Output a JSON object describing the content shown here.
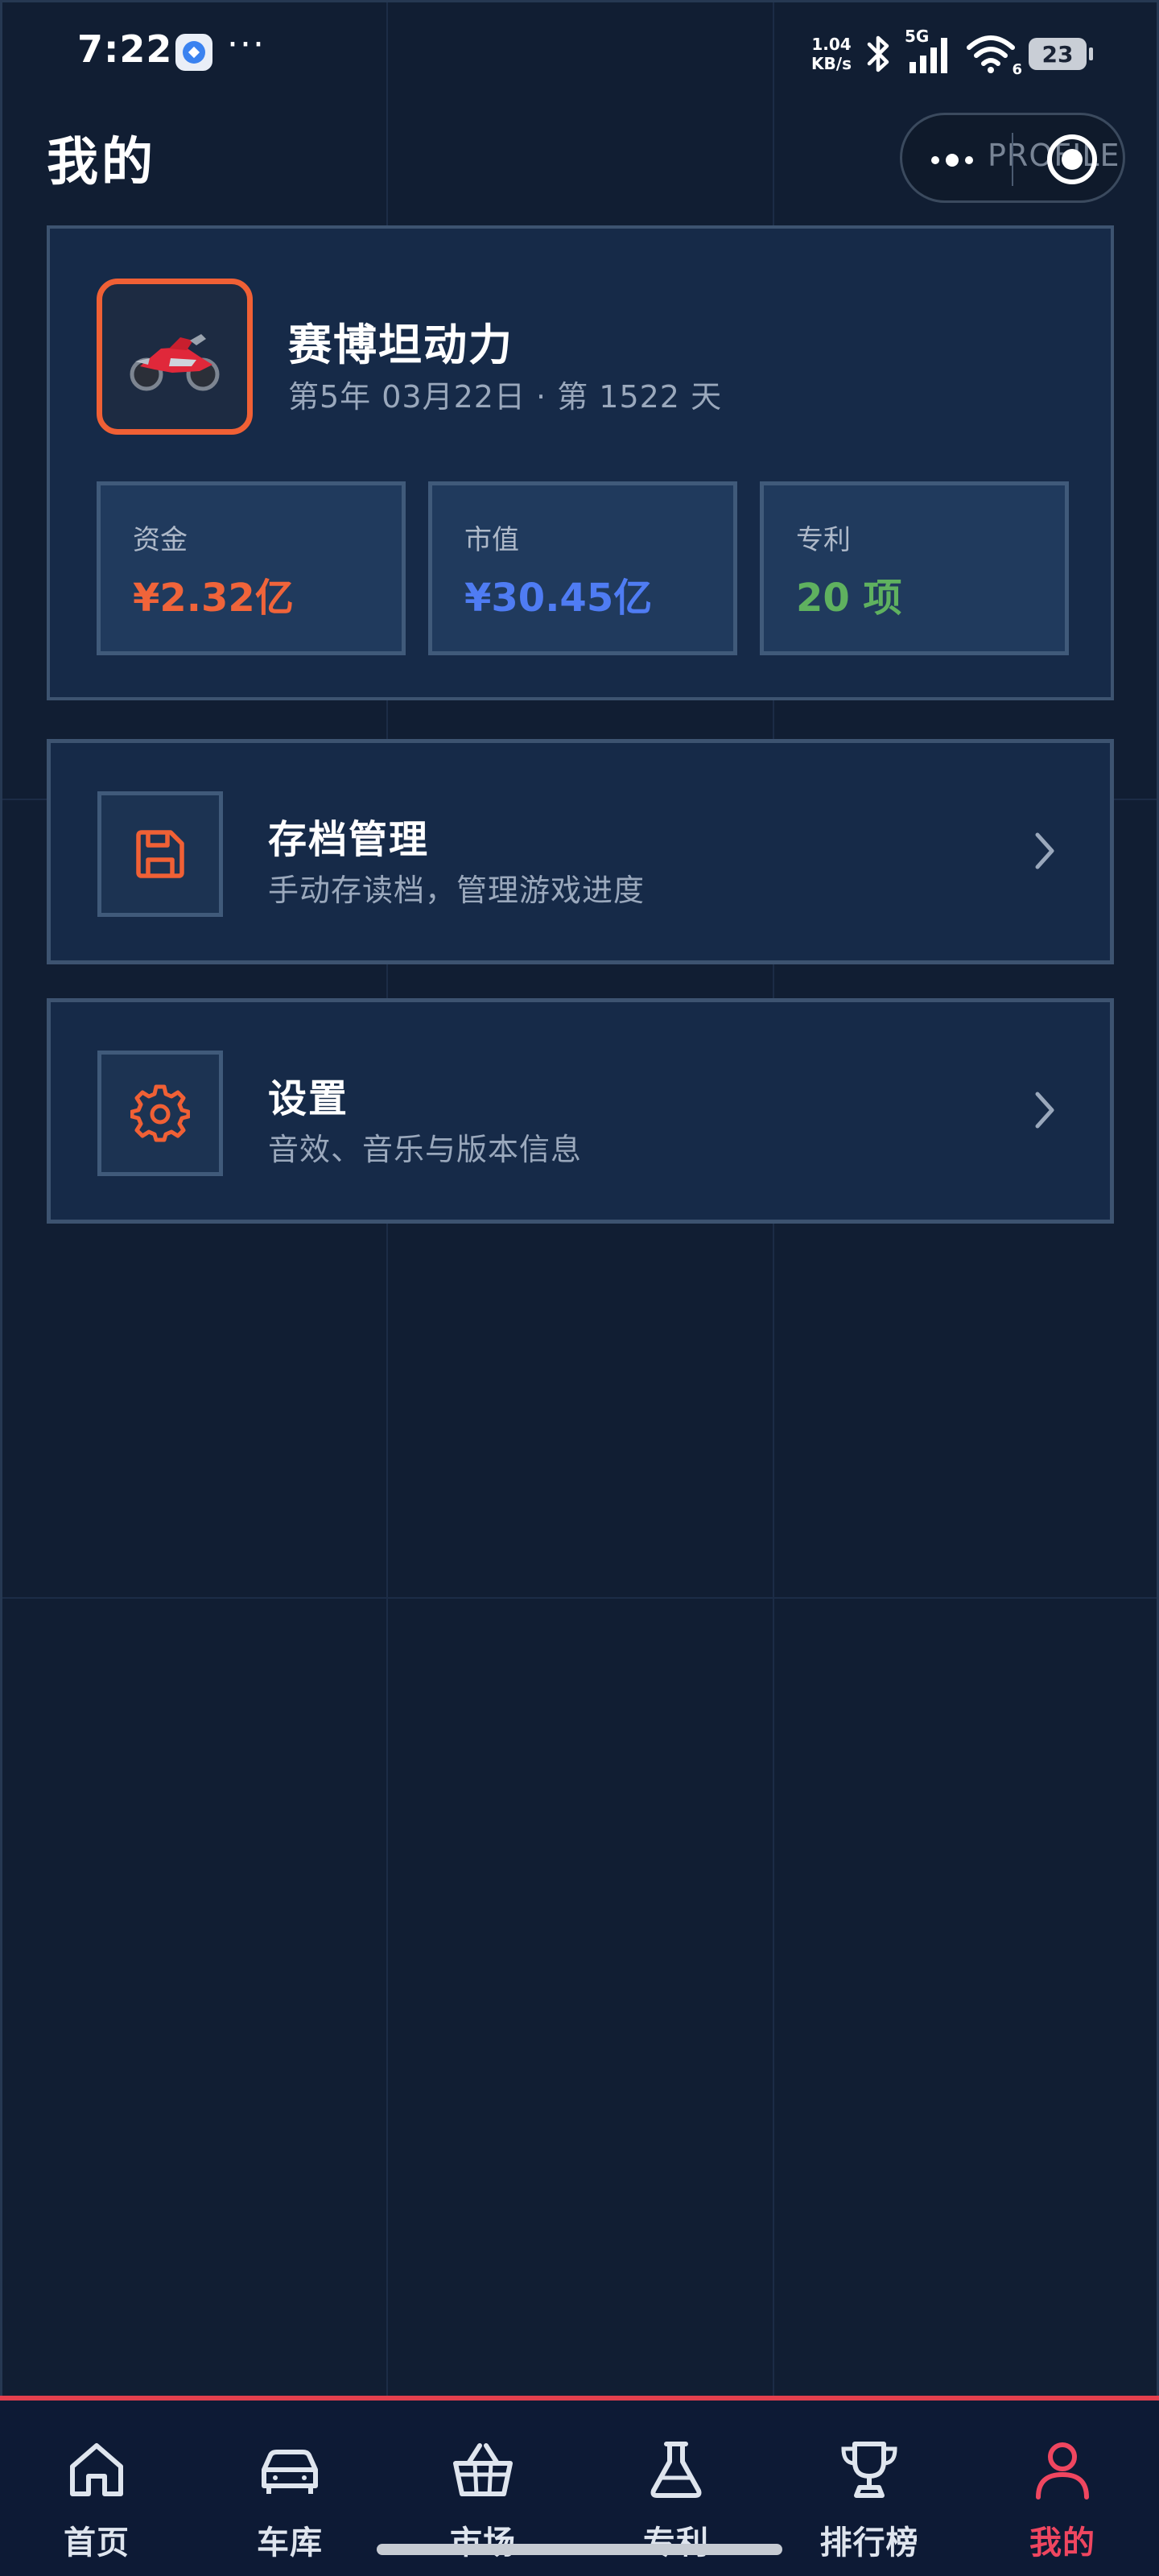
{
  "status_bar": {
    "time": "7:22",
    "more": "···",
    "net_speed_value": "1.04",
    "net_speed_unit": "KB/s",
    "network": "5G",
    "wifi_level": "6",
    "battery": "23"
  },
  "header": {
    "title": "我的",
    "capsule_ghost_text": "PROFILE"
  },
  "profile": {
    "avatar_icon": "motorcycle-icon",
    "company_name": "赛博坦动力",
    "subtitle": "第5年 03月22日 · 第 1522 天",
    "stats": [
      {
        "label": "资金",
        "value": "¥2.32亿",
        "color": "#f0643a"
      },
      {
        "label": "市值",
        "value": "¥30.45亿",
        "color": "#4f7cf3"
      },
      {
        "label": "专利",
        "value": "20 项",
        "color": "#5fb15f"
      }
    ]
  },
  "menu": [
    {
      "title": "存档管理",
      "subtitle": "手动存读档，管理游戏进度",
      "icon": "save-icon"
    },
    {
      "title": "设置",
      "subtitle": "音效、音乐与版本信息",
      "icon": "gear-icon"
    }
  ],
  "tabs": [
    {
      "label": "首页",
      "icon": "home-icon",
      "active": false
    },
    {
      "label": "车库",
      "icon": "car-icon",
      "active": false
    },
    {
      "label": "市场",
      "icon": "basket-icon",
      "active": false
    },
    {
      "label": "专利",
      "icon": "flask-icon",
      "active": false
    },
    {
      "label": "排行榜",
      "icon": "trophy-icon",
      "active": false
    },
    {
      "label": "我的",
      "icon": "user-icon",
      "active": true
    }
  ],
  "colors": {
    "background": "#111e33",
    "accent": "#f06035",
    "active_tab": "#ef4660"
  }
}
